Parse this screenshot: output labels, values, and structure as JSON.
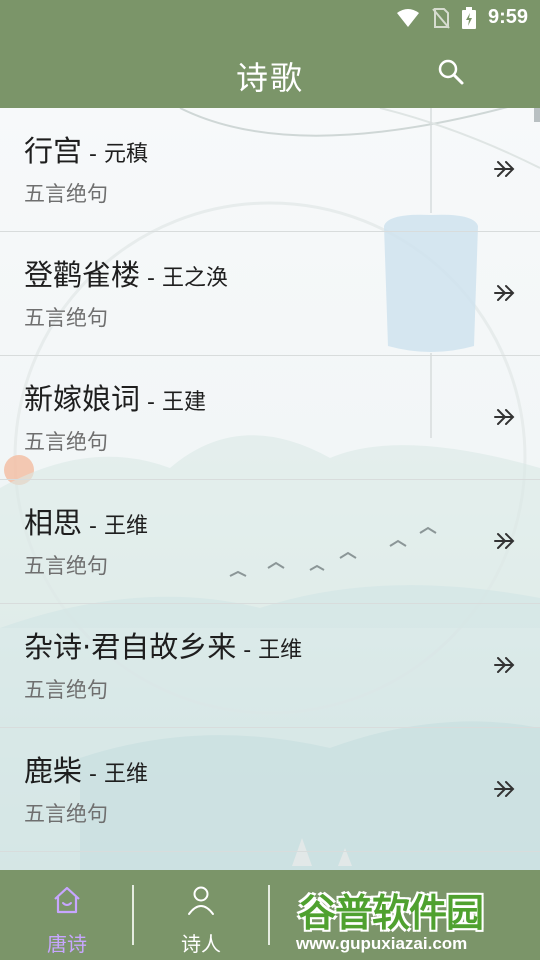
{
  "status_bar": {
    "time": "9:59"
  },
  "app_bar": {
    "title": "诗歌"
  },
  "poems": [
    {
      "title": "行宫",
      "author": "元稹",
      "type": "五言绝句"
    },
    {
      "title": "登鹳雀楼",
      "author": "王之涣",
      "type": "五言绝句"
    },
    {
      "title": "新嫁娘词",
      "author": "王建",
      "type": "五言绝句"
    },
    {
      "title": "相思",
      "author": "王维",
      "type": "五言绝句"
    },
    {
      "title": "杂诗·君自故乡来",
      "author": "王维",
      "type": "五言绝句"
    },
    {
      "title": "鹿柴",
      "author": "王维",
      "type": "五言绝句"
    }
  ],
  "bottom_nav": {
    "items": [
      {
        "label": "唐诗",
        "icon": "home-icon",
        "active": true
      },
      {
        "label": "诗人",
        "icon": "person-icon",
        "active": false
      }
    ]
  },
  "watermark": {
    "logo": "谷普软件园",
    "url": "www.gupuxiazai.com"
  },
  "colors": {
    "bar": "#7b9569",
    "active_tab": "#c7a6ff"
  }
}
